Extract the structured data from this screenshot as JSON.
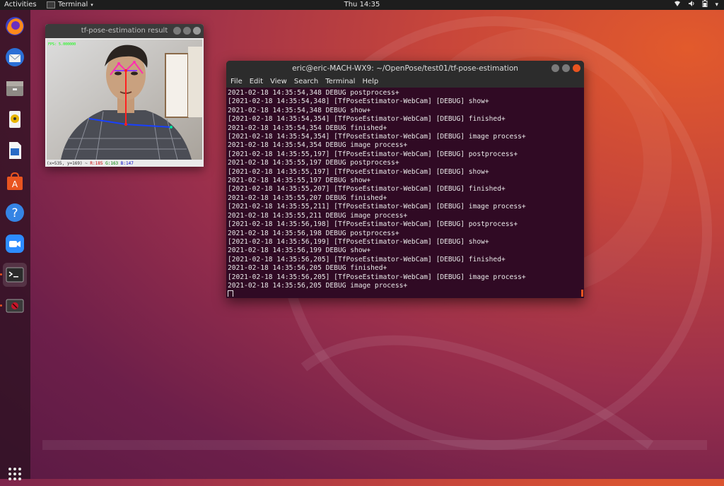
{
  "topbar": {
    "activities": "Activities",
    "app_menu": "Terminal",
    "clock": "Thu 14:35"
  },
  "dock": {
    "items": [
      {
        "name": "firefox-icon"
      },
      {
        "name": "thunderbird-icon"
      },
      {
        "name": "files-icon"
      },
      {
        "name": "rhythmbox-icon"
      },
      {
        "name": "libreoffice-writer-icon"
      },
      {
        "name": "software-center-icon"
      },
      {
        "name": "help-icon"
      },
      {
        "name": "zoom-icon"
      },
      {
        "name": "terminal-icon"
      },
      {
        "name": "pose-viewer-icon"
      }
    ]
  },
  "pose_window": {
    "title": "tf-pose-estimation result",
    "fps_overlay": "FPS: 5.000000",
    "status_prefix": "(x=535, y=169) ~",
    "status_r": "R:185",
    "status_g": "G:163",
    "status_b": "B:147"
  },
  "terminal": {
    "title": "eric@eric-MACH-WX9: ~/OpenPose/test01/tf-pose-estimation",
    "menu": [
      "File",
      "Edit",
      "View",
      "Search",
      "Terminal",
      "Help"
    ],
    "lines": [
      "2021-02-18 14:35:54,348 DEBUG postprocess+",
      "[2021-02-18 14:35:54,348] [TfPoseEstimator-WebCam] [DEBUG] show+",
      "2021-02-18 14:35:54,348 DEBUG show+",
      "[2021-02-18 14:35:54,354] [TfPoseEstimator-WebCam] [DEBUG] finished+",
      "2021-02-18 14:35:54,354 DEBUG finished+",
      "[2021-02-18 14:35:54,354] [TfPoseEstimator-WebCam] [DEBUG] image process+",
      "2021-02-18 14:35:54,354 DEBUG image process+",
      "[2021-02-18 14:35:55,197] [TfPoseEstimator-WebCam] [DEBUG] postprocess+",
      "2021-02-18 14:35:55,197 DEBUG postprocess+",
      "[2021-02-18 14:35:55,197] [TfPoseEstimator-WebCam] [DEBUG] show+",
      "2021-02-18 14:35:55,197 DEBUG show+",
      "[2021-02-18 14:35:55,207] [TfPoseEstimator-WebCam] [DEBUG] finished+",
      "2021-02-18 14:35:55,207 DEBUG finished+",
      "[2021-02-18 14:35:55,211] [TfPoseEstimator-WebCam] [DEBUG] image process+",
      "2021-02-18 14:35:55,211 DEBUG image process+",
      "[2021-02-18 14:35:56,198] [TfPoseEstimator-WebCam] [DEBUG] postprocess+",
      "2021-02-18 14:35:56,198 DEBUG postprocess+",
      "[2021-02-18 14:35:56,199] [TfPoseEstimator-WebCam] [DEBUG] show+",
      "2021-02-18 14:35:56,199 DEBUG show+",
      "[2021-02-18 14:35:56,205] [TfPoseEstimator-WebCam] [DEBUG] finished+",
      "2021-02-18 14:35:56,205 DEBUG finished+",
      "[2021-02-18 14:35:56,205] [TfPoseEstimator-WebCam] [DEBUG] image process+",
      "2021-02-18 14:35:56,205 DEBUG image process+"
    ]
  },
  "colors": {
    "accent": "#e95420",
    "terminal_bg": "#300a24",
    "topbar_bg": "#1d1d1d"
  }
}
